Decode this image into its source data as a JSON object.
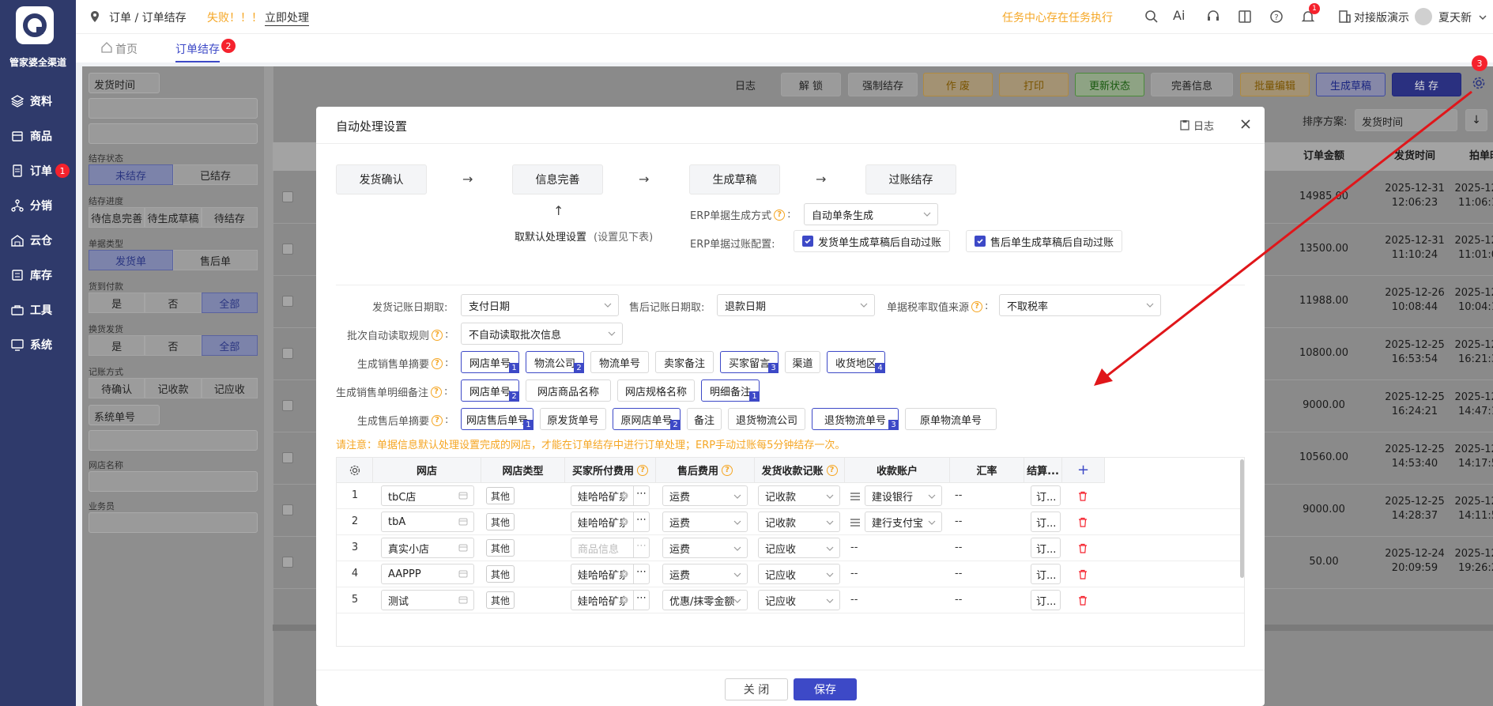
{
  "colors": {
    "brand": "#2f3a6b",
    "primary": "#3d49c7",
    "warning": "#f5a623",
    "danger": "#f5222d",
    "success": "#52c41a"
  },
  "app": {
    "brand": "管家婆全渠道"
  },
  "sidebar": {
    "items": [
      {
        "label": "资料",
        "icon": "layers-icon"
      },
      {
        "label": "商品",
        "icon": "box-icon"
      },
      {
        "label": "订单",
        "icon": "document-icon",
        "badge": "1"
      },
      {
        "label": "分销",
        "icon": "network-icon"
      },
      {
        "label": "云仓",
        "icon": "warehouse-icon"
      },
      {
        "label": "库存",
        "icon": "inventory-icon"
      },
      {
        "label": "工具",
        "icon": "toolbox-icon"
      },
      {
        "label": "系统",
        "icon": "monitor-icon"
      }
    ]
  },
  "header": {
    "breadcrumb": "订单 / 订单结存",
    "error_text": "失败！！！",
    "action_link": "立即处理",
    "task_notice": "任务中心存在任务执行",
    "ai_label": "Ai",
    "bell_badge": "1",
    "org_name": "对接版演示",
    "user_name": "夏天新"
  },
  "tabs": [
    {
      "label": "首页",
      "active": false
    },
    {
      "label": "订单结存",
      "active": true,
      "badge": "2"
    }
  ],
  "gear_badge": "3",
  "background": {
    "filter": {
      "ship_time": "发货时间",
      "status_label": "结存状态",
      "status_opts": [
        "未结存",
        "已结存"
      ],
      "progress_label": "结存进度",
      "progress_opts": [
        "待信息完善",
        "待生成草稿",
        "待结存"
      ],
      "type_label": "单据类型",
      "type_opts": [
        "发货单",
        "售后单"
      ],
      "cod_label": "货到付款",
      "cod_opts": [
        "是",
        "否",
        "全部"
      ],
      "exchange_label": "换货发货",
      "exchange_opts": [
        "是",
        "否",
        "全部"
      ],
      "account_label": "记账方式",
      "account_opts": [
        "待确认",
        "记收款",
        "记应收"
      ],
      "sys_no": "系统单号",
      "shop_label": "网店名称",
      "salesman_label": "业务员"
    },
    "toolbar": {
      "log": "日志",
      "unlock": "解 锁",
      "force": "强制结存",
      "void": "作 废",
      "print": "打印",
      "update": "更新状态",
      "complete": "完善信息",
      "batch": "批量编辑",
      "draft": "生成草稿",
      "settle": "结 存"
    },
    "sort_label": "排序方案:",
    "sort_value": "发货时间",
    "columns": [
      "订单金额",
      "发货时间",
      "拍单时间"
    ],
    "rows": [
      {
        "amount": "14985.00",
        "ship": "2025-12-31 12:06:23",
        "order": "2025-12- 11:06:1"
      },
      {
        "amount": "13500.00",
        "ship": "2025-12-31 11:10:24",
        "order": "2025-12- 11:01:0"
      },
      {
        "amount": "11988.00",
        "ship": "2025-12-26 10:08:44",
        "order": "2025-12- 10:04:1"
      },
      {
        "amount": "10800.00",
        "ship": "2025-12-25 16:53:54",
        "order": "2025-12- 16:21:3"
      },
      {
        "amount": "9000.00",
        "ship": "2025-12-25 16:24:21",
        "order": "2025-12- 14:47:1"
      },
      {
        "amount": "10560.00",
        "ship": "2025-12-25 14:53:40",
        "order": "2025-12- 14:17:5"
      },
      {
        "amount": "9000.00",
        "ship": "2025-12-25 14:28:37",
        "order": "2025-12- 14:11:5"
      },
      {
        "amount": "50.00",
        "ship": "2025-12-24 20:09:59",
        "order": "2025-12- 19:26:2"
      }
    ]
  },
  "modal": {
    "title": "自动处理设置",
    "log": "日志",
    "steps": [
      "发货确认",
      "信息完善",
      "生成草稿",
      "过账结存"
    ],
    "default_setting": "取默认处理设置",
    "default_hint": "(设置见下表)",
    "erp_gen_label": "ERP单据生成方式",
    "erp_gen_value": "自动单条生成",
    "erp_post_label": "ERP单据过账配置:",
    "post_opt1": "发货单生成草稿后自动过账",
    "post_opt2": "售后单生成草稿后自动过账",
    "ship_date_label": "发货记账日期取:",
    "ship_date_value": "支付日期",
    "after_date_label": "售后记账日期取:",
    "after_date_value": "退款日期",
    "tax_label": "单据税率取值来源",
    "tax_value": "不取税率",
    "batch_label": "批次自动读取规则",
    "batch_value": "不自动读取批次信息",
    "sales_summary_label": "生成销售单摘要",
    "sales_summary_tags": [
      {
        "t": "网店单号",
        "n": "1"
      },
      {
        "t": "物流公司",
        "n": "2"
      },
      {
        "t": "物流单号"
      },
      {
        "t": "卖家备注"
      },
      {
        "t": "买家留言",
        "n": "3"
      },
      {
        "t": "渠道"
      },
      {
        "t": "收货地区",
        "n": "4"
      }
    ],
    "sales_detail_label": "生成销售单明细备注",
    "sales_detail_tags": [
      {
        "t": "网店单号",
        "n": "2"
      },
      {
        "t": "网店商品名称"
      },
      {
        "t": "网店规格名称"
      },
      {
        "t": "明细备注",
        "n": "1"
      }
    ],
    "after_summary_label": "生成售后单摘要",
    "after_summary_tags": [
      {
        "t": "网店售后单号",
        "n": "1"
      },
      {
        "t": "原发货单号"
      },
      {
        "t": "原网店单号",
        "n": "2"
      },
      {
        "t": "备注"
      },
      {
        "t": "退货物流公司"
      },
      {
        "t": "退货物流单号",
        "n": "3"
      },
      {
        "t": "原单物流单号"
      }
    ],
    "notice": "请注意：单据信息默认处理设置完成的网店，才能在订单结存中进行订单处理；ERP手动过账每5分钟结存一次。",
    "table": {
      "headers": [
        "网店",
        "网店类型",
        "买家所付费用",
        "售后费用",
        "发货收款记账",
        "收款账户",
        "汇率",
        "结算..."
      ],
      "rows": [
        {
          "no": "1",
          "shop": "tbC店",
          "type": "其他",
          "fee": "娃哈哈矿泉",
          "after": "运费",
          "acct": "记收款",
          "account": "建设银行",
          "rate": "--",
          "settle": "订..."
        },
        {
          "no": "2",
          "shop": "tbA",
          "type": "其他",
          "fee": "娃哈哈矿泉",
          "after": "运费",
          "acct": "记收款",
          "account": "建行支付宝",
          "rate": "--",
          "settle": "订..."
        },
        {
          "no": "3",
          "shop": "真实小店",
          "type": "其他",
          "fee_placeholder": "商品信息",
          "after": "运费",
          "acct": "记应收",
          "account": "--",
          "rate": "--",
          "settle": "订..."
        },
        {
          "no": "4",
          "shop": "AAPPP",
          "type": "其他",
          "fee": "娃哈哈矿泉",
          "after": "运费",
          "acct": "记应收",
          "account": "--",
          "rate": "--",
          "settle": "订..."
        },
        {
          "no": "5",
          "shop": "测试",
          "type": "其他",
          "fee": "娃哈哈矿泉",
          "after": "优惠/抹零金额",
          "acct": "记应收",
          "account": "--",
          "rate": "--",
          "settle": "订..."
        }
      ]
    },
    "close_btn": "关 闭",
    "save_btn": "保存"
  }
}
